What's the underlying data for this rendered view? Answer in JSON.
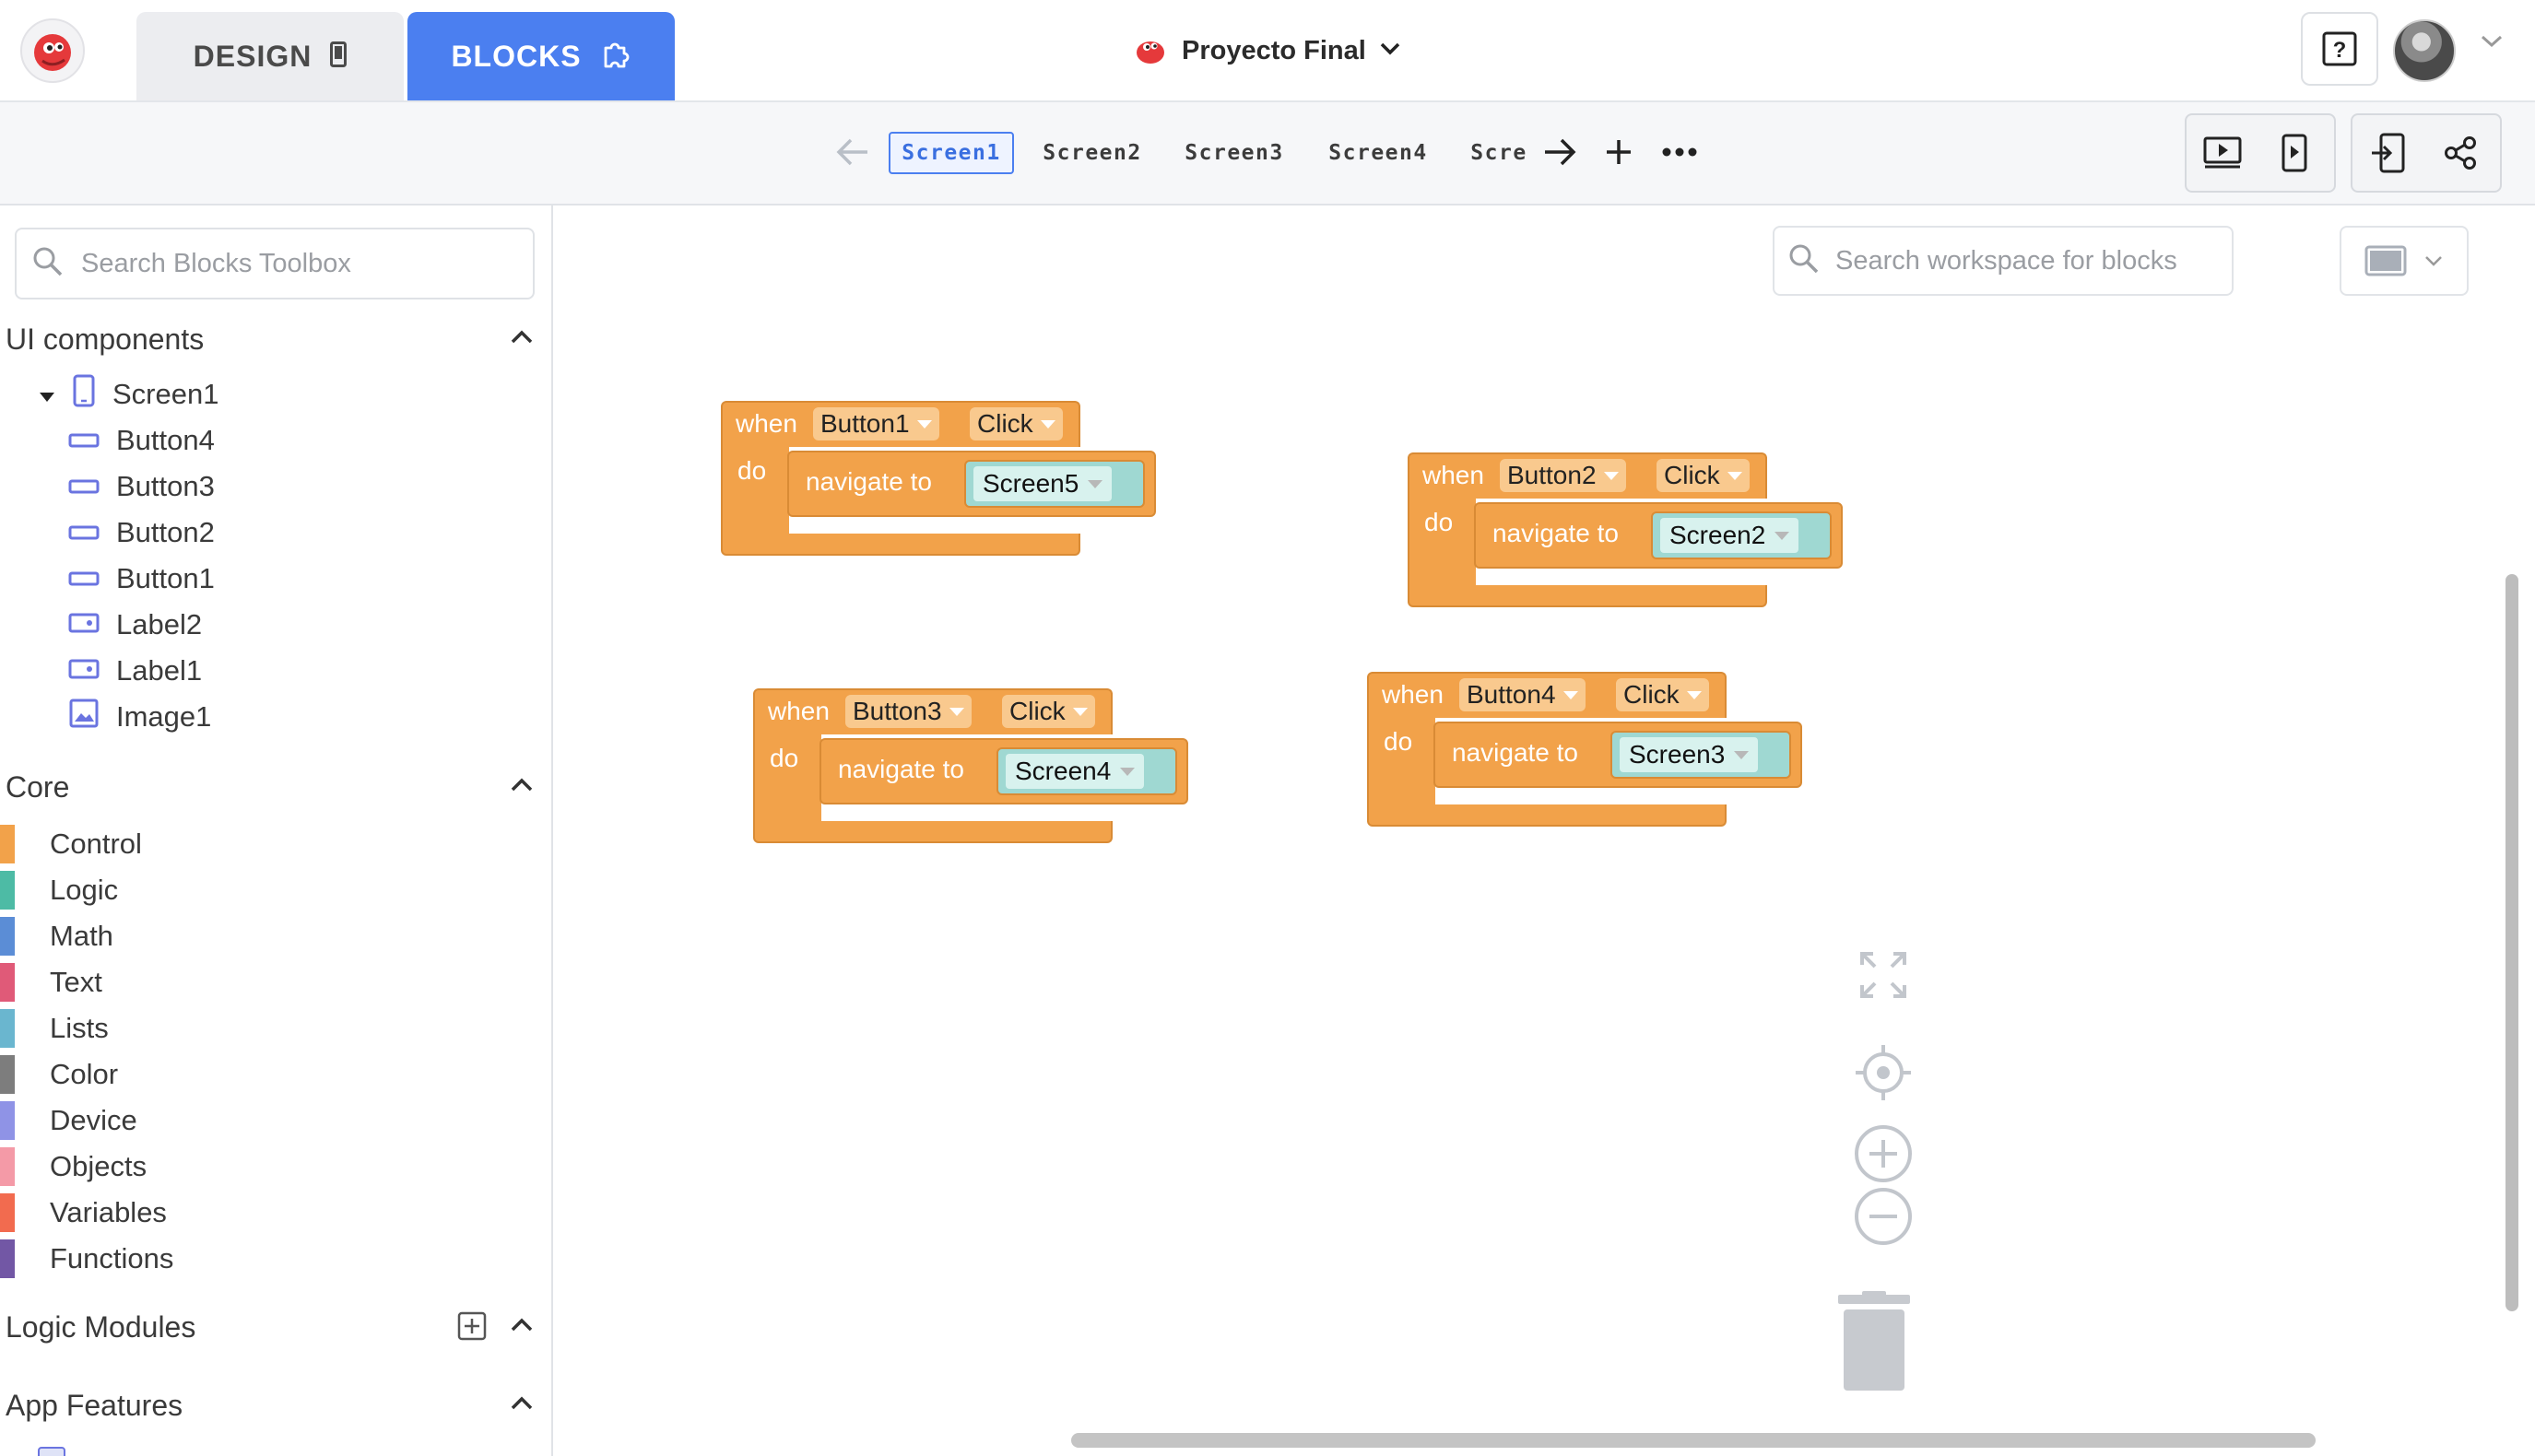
{
  "header": {
    "tabs": [
      {
        "label": "DESIGN",
        "icon": "phone-icon",
        "active": false
      },
      {
        "label": "BLOCKS",
        "icon": "puzzle-icon",
        "active": true
      }
    ],
    "project_name": "Proyecto Final",
    "help_label": "?",
    "accent_color": "#4b7ff0"
  },
  "screens": {
    "tabs": [
      "Screen1",
      "Screen2",
      "Screen3",
      "Screen4",
      "Scre"
    ],
    "active": "Screen1"
  },
  "toolbox": {
    "search_placeholder": "Search Blocks Toolbox",
    "ui_components": {
      "title": "UI components",
      "items": [
        {
          "label": "Screen1",
          "icon": "screen-icon"
        },
        {
          "label": "Button4",
          "icon": "button-icon"
        },
        {
          "label": "Button3",
          "icon": "button-icon"
        },
        {
          "label": "Button2",
          "icon": "button-icon"
        },
        {
          "label": "Button1",
          "icon": "button-icon"
        },
        {
          "label": "Label2",
          "icon": "label-icon"
        },
        {
          "label": "Label1",
          "icon": "label-icon"
        },
        {
          "label": "Image1",
          "icon": "image-icon"
        }
      ]
    },
    "core": {
      "title": "Core",
      "items": [
        {
          "label": "Control",
          "color": "#f2a24a"
        },
        {
          "label": "Logic",
          "color": "#4dbba5"
        },
        {
          "label": "Math",
          "color": "#5b8dd6"
        },
        {
          "label": "Text",
          "color": "#e05a78"
        },
        {
          "label": "Lists",
          "color": "#6ab6cf"
        },
        {
          "label": "Color",
          "color": "#7d7d7d"
        },
        {
          "label": "Device",
          "color": "#8f93e6"
        },
        {
          "label": "Objects",
          "color": "#f49aa7"
        },
        {
          "label": "Variables",
          "color": "#f26b4f"
        },
        {
          "label": "Functions",
          "color": "#7257a5"
        }
      ]
    },
    "logic_modules": {
      "title": "Logic Modules"
    },
    "app_features": {
      "title": "App Features"
    }
  },
  "workspace": {
    "search_placeholder": "Search workspace for blocks",
    "blocks": [
      {
        "when": "when",
        "component": "Button1",
        "event": "Click",
        "do": "do",
        "action": "navigate to",
        "screen": "Screen5"
      },
      {
        "when": "when",
        "component": "Button2",
        "event": "Click",
        "do": "do",
        "action": "navigate to",
        "screen": "Screen2"
      },
      {
        "when": "when",
        "component": "Button3",
        "event": "Click",
        "do": "do",
        "action": "navigate to",
        "screen": "Screen4"
      },
      {
        "when": "when",
        "component": "Button4",
        "event": "Click",
        "do": "do",
        "action": "navigate to",
        "screen": "Screen3"
      }
    ],
    "block_color": "#f2a24a"
  }
}
